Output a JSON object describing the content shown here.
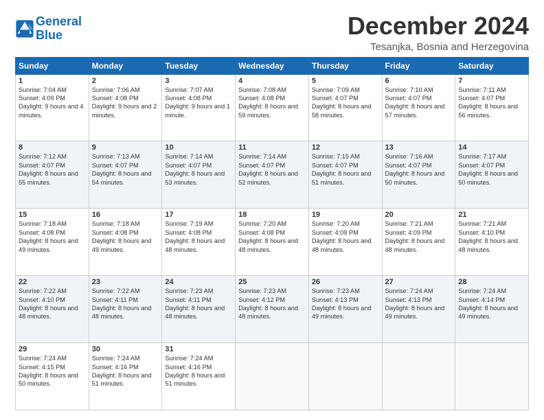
{
  "logo": {
    "line1": "General",
    "line2": "Blue"
  },
  "title": "December 2024",
  "subtitle": "Tesanjka, Bosnia and Herzegovina",
  "weekdays": [
    "Sunday",
    "Monday",
    "Tuesday",
    "Wednesday",
    "Thursday",
    "Friday",
    "Saturday"
  ],
  "weeks": [
    [
      {
        "day": "1",
        "sunrise": "7:04 AM",
        "sunset": "4:09 PM",
        "daylight": "9 hours and 4 minutes."
      },
      {
        "day": "2",
        "sunrise": "7:06 AM",
        "sunset": "4:08 PM",
        "daylight": "9 hours and 2 minutes."
      },
      {
        "day": "3",
        "sunrise": "7:07 AM",
        "sunset": "4:08 PM",
        "daylight": "9 hours and 1 minute."
      },
      {
        "day": "4",
        "sunrise": "7:08 AM",
        "sunset": "4:08 PM",
        "daylight": "8 hours and 59 minutes."
      },
      {
        "day": "5",
        "sunrise": "7:09 AM",
        "sunset": "4:07 PM",
        "daylight": "8 hours and 58 minutes."
      },
      {
        "day": "6",
        "sunrise": "7:10 AM",
        "sunset": "4:07 PM",
        "daylight": "8 hours and 57 minutes."
      },
      {
        "day": "7",
        "sunrise": "7:11 AM",
        "sunset": "4:07 PM",
        "daylight": "8 hours and 56 minutes."
      }
    ],
    [
      {
        "day": "8",
        "sunrise": "7:12 AM",
        "sunset": "4:07 PM",
        "daylight": "8 hours and 55 minutes."
      },
      {
        "day": "9",
        "sunrise": "7:13 AM",
        "sunset": "4:07 PM",
        "daylight": "8 hours and 54 minutes."
      },
      {
        "day": "10",
        "sunrise": "7:14 AM",
        "sunset": "4:07 PM",
        "daylight": "8 hours and 53 minutes."
      },
      {
        "day": "11",
        "sunrise": "7:14 AM",
        "sunset": "4:07 PM",
        "daylight": "8 hours and 52 minutes."
      },
      {
        "day": "12",
        "sunrise": "7:15 AM",
        "sunset": "4:07 PM",
        "daylight": "8 hours and 51 minutes."
      },
      {
        "day": "13",
        "sunrise": "7:16 AM",
        "sunset": "4:07 PM",
        "daylight": "8 hours and 50 minutes."
      },
      {
        "day": "14",
        "sunrise": "7:17 AM",
        "sunset": "4:07 PM",
        "daylight": "8 hours and 50 minutes."
      }
    ],
    [
      {
        "day": "15",
        "sunrise": "7:18 AM",
        "sunset": "4:08 PM",
        "daylight": "8 hours and 49 minutes."
      },
      {
        "day": "16",
        "sunrise": "7:18 AM",
        "sunset": "4:08 PM",
        "daylight": "8 hours and 49 minutes."
      },
      {
        "day": "17",
        "sunrise": "7:19 AM",
        "sunset": "4:08 PM",
        "daylight": "8 hours and 48 minutes."
      },
      {
        "day": "18",
        "sunrise": "7:20 AM",
        "sunset": "4:08 PM",
        "daylight": "8 hours and 48 minutes."
      },
      {
        "day": "19",
        "sunrise": "7:20 AM",
        "sunset": "4:09 PM",
        "daylight": "8 hours and 48 minutes."
      },
      {
        "day": "20",
        "sunrise": "7:21 AM",
        "sunset": "4:09 PM",
        "daylight": "8 hours and 48 minutes."
      },
      {
        "day": "21",
        "sunrise": "7:21 AM",
        "sunset": "4:10 PM",
        "daylight": "8 hours and 48 minutes."
      }
    ],
    [
      {
        "day": "22",
        "sunrise": "7:22 AM",
        "sunset": "4:10 PM",
        "daylight": "8 hours and 48 minutes."
      },
      {
        "day": "23",
        "sunrise": "7:22 AM",
        "sunset": "4:11 PM",
        "daylight": "8 hours and 48 minutes."
      },
      {
        "day": "24",
        "sunrise": "7:23 AM",
        "sunset": "4:11 PM",
        "daylight": "8 hours and 48 minutes."
      },
      {
        "day": "25",
        "sunrise": "7:23 AM",
        "sunset": "4:12 PM",
        "daylight": "8 hours and 48 minutes."
      },
      {
        "day": "26",
        "sunrise": "7:23 AM",
        "sunset": "4:13 PM",
        "daylight": "8 hours and 49 minutes."
      },
      {
        "day": "27",
        "sunrise": "7:24 AM",
        "sunset": "4:13 PM",
        "daylight": "8 hours and 49 minutes."
      },
      {
        "day": "28",
        "sunrise": "7:24 AM",
        "sunset": "4:14 PM",
        "daylight": "8 hours and 49 minutes."
      }
    ],
    [
      {
        "day": "29",
        "sunrise": "7:24 AM",
        "sunset": "4:15 PM",
        "daylight": "8 hours and 50 minutes."
      },
      {
        "day": "30",
        "sunrise": "7:24 AM",
        "sunset": "4:16 PM",
        "daylight": "8 hours and 51 minutes."
      },
      {
        "day": "31",
        "sunrise": "7:24 AM",
        "sunset": "4:16 PM",
        "daylight": "8 hours and 51 minutes."
      },
      null,
      null,
      null,
      null
    ]
  ],
  "labels": {
    "sunrise": "Sunrise:",
    "sunset": "Sunset:",
    "daylight": "Daylight:"
  }
}
